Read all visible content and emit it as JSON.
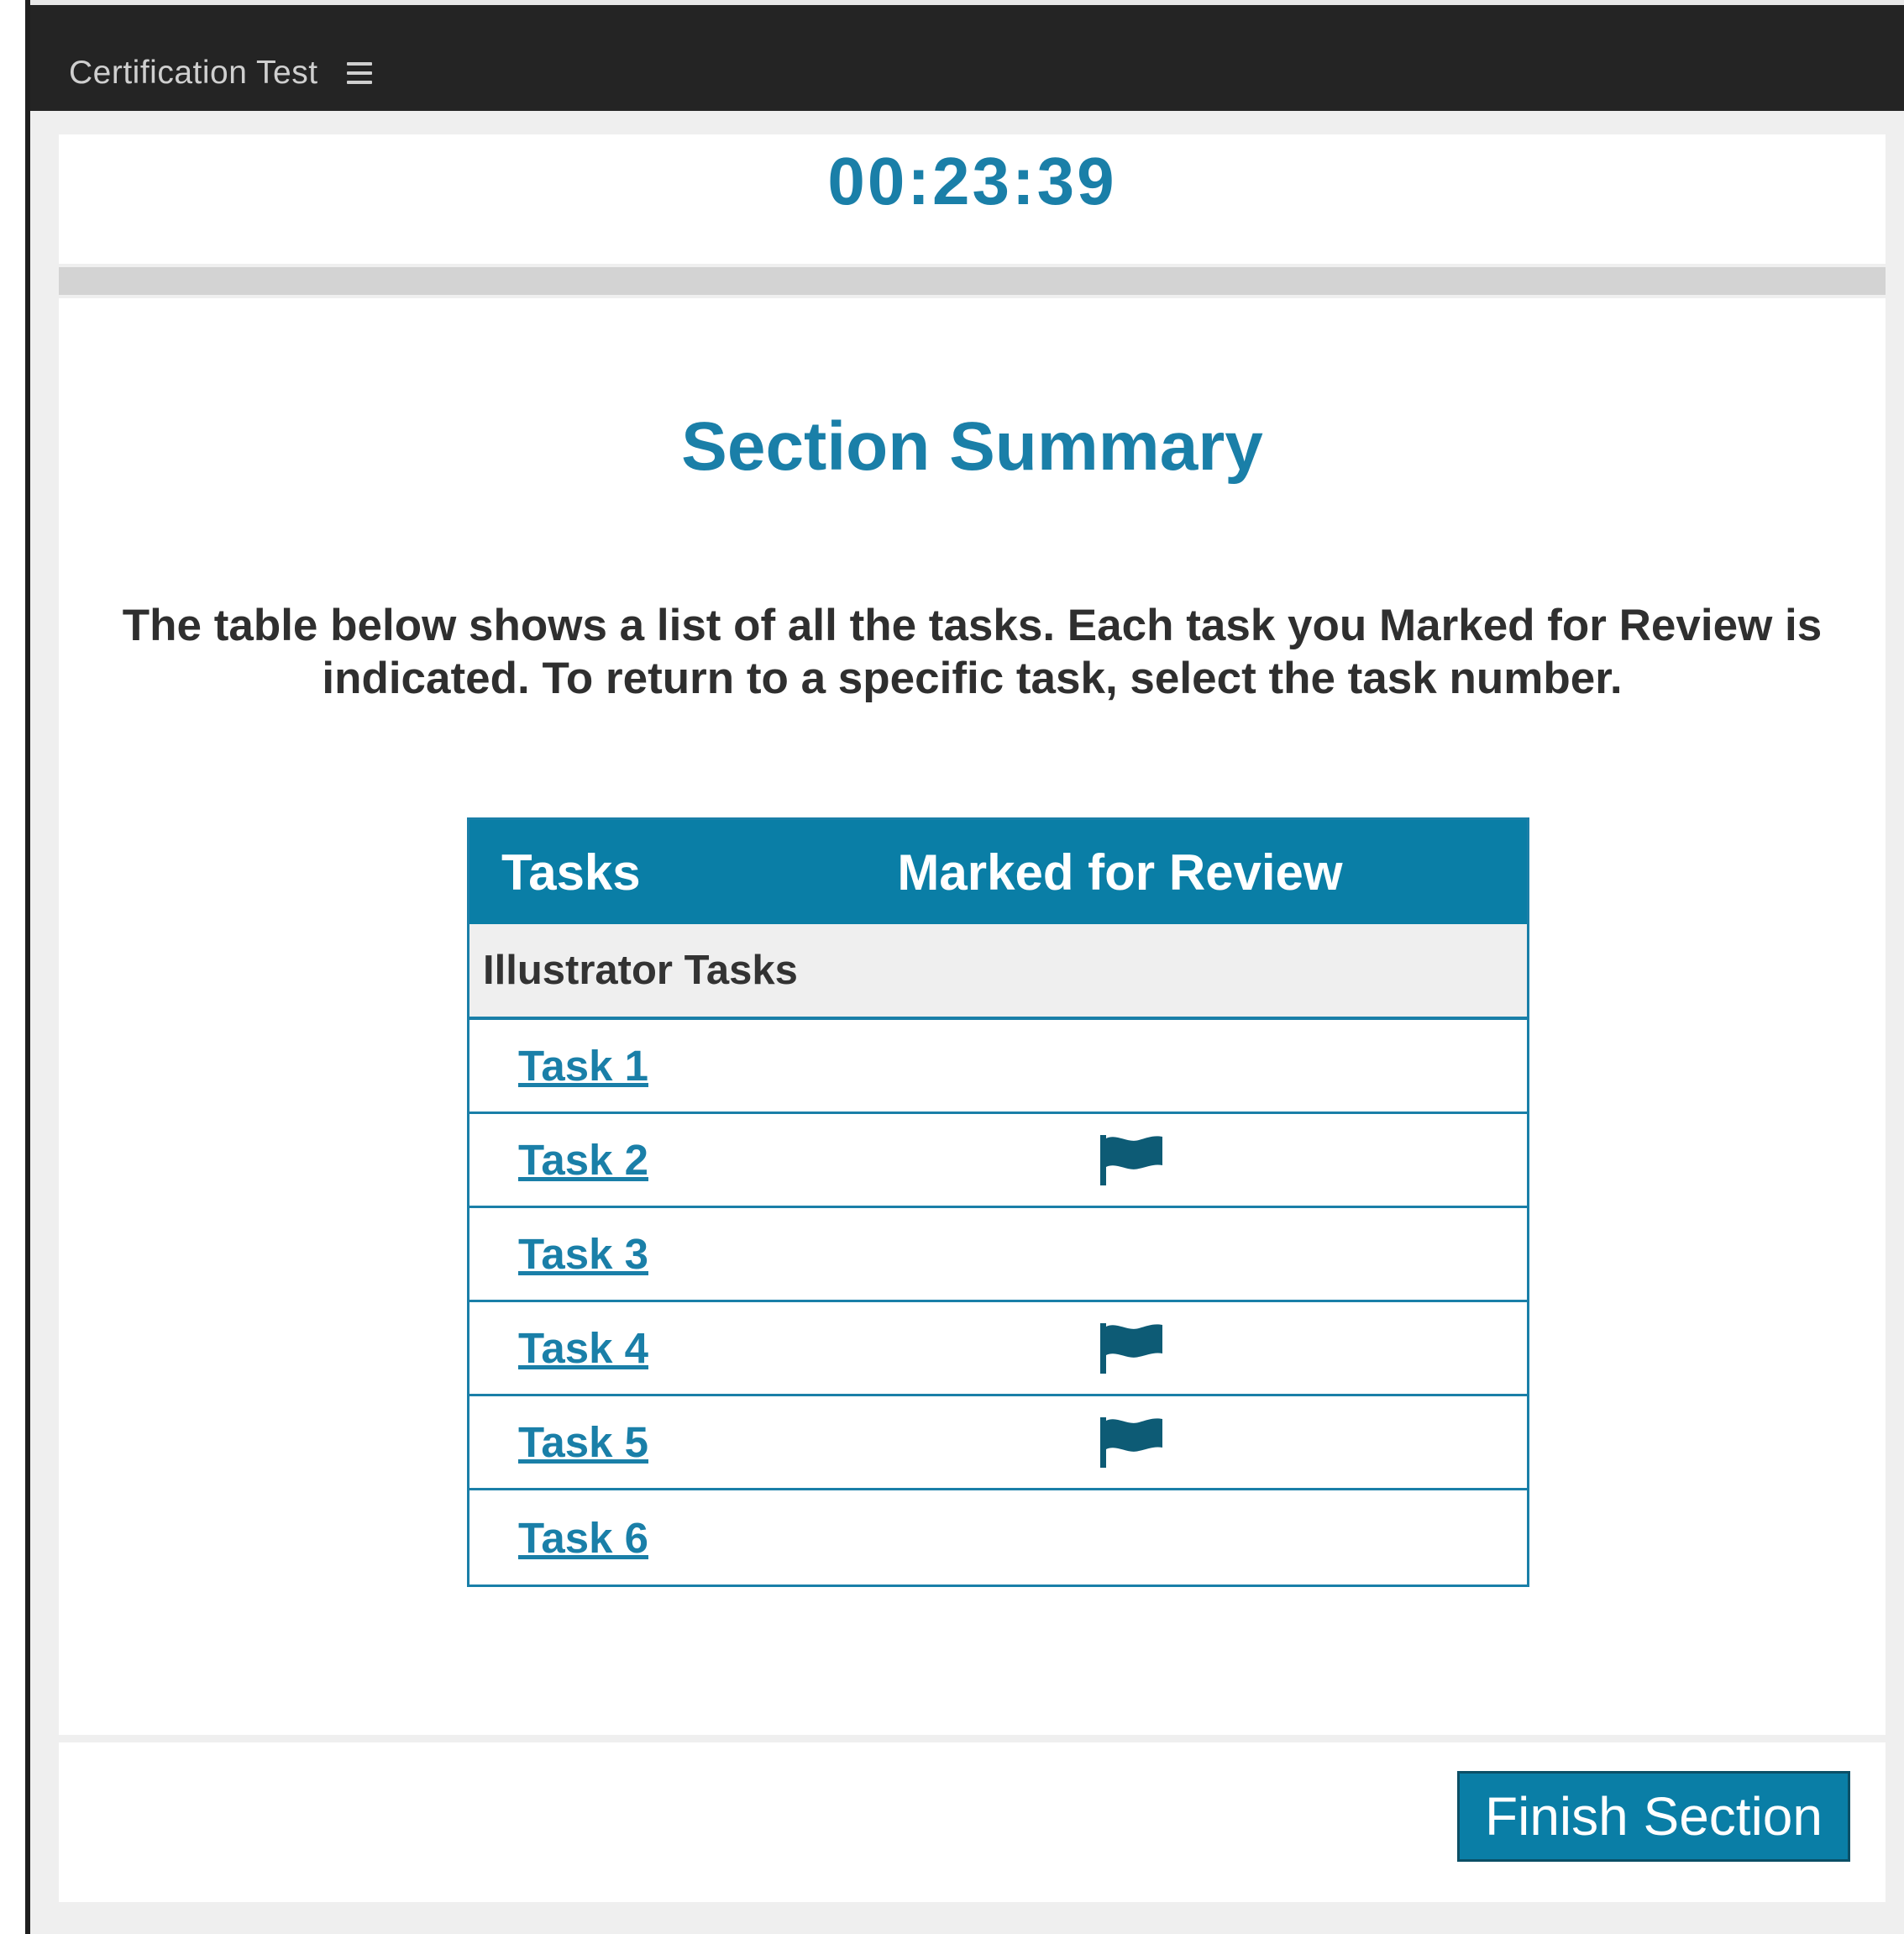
{
  "app": {
    "title": "Certification Test",
    "menu_icon": "hamburger-menu-icon"
  },
  "timer": "00:23:39",
  "section": {
    "title": "Section Summary",
    "instructions": "The table below shows a list of all the tasks. Each task you Marked for Review is indicated. To return to a specific task, select the task number."
  },
  "table": {
    "headers": [
      "Tasks",
      "Marked for Review"
    ],
    "group_label": "Illustrator Tasks",
    "rows": [
      {
        "label": "Task 1",
        "marked": false
      },
      {
        "label": "Task 2",
        "marked": true
      },
      {
        "label": "Task 3",
        "marked": false
      },
      {
        "label": "Task 4",
        "marked": true
      },
      {
        "label": "Task 5",
        "marked": true
      },
      {
        "label": "Task 6",
        "marked": false
      }
    ],
    "flag_icon": "flag-icon"
  },
  "footer": {
    "finish_label": "Finish Section"
  },
  "colors": {
    "accent": "#0a7ea6",
    "text_accent": "#1a7fa8",
    "titlebar": "#242424",
    "flag": "#0d5b75"
  }
}
